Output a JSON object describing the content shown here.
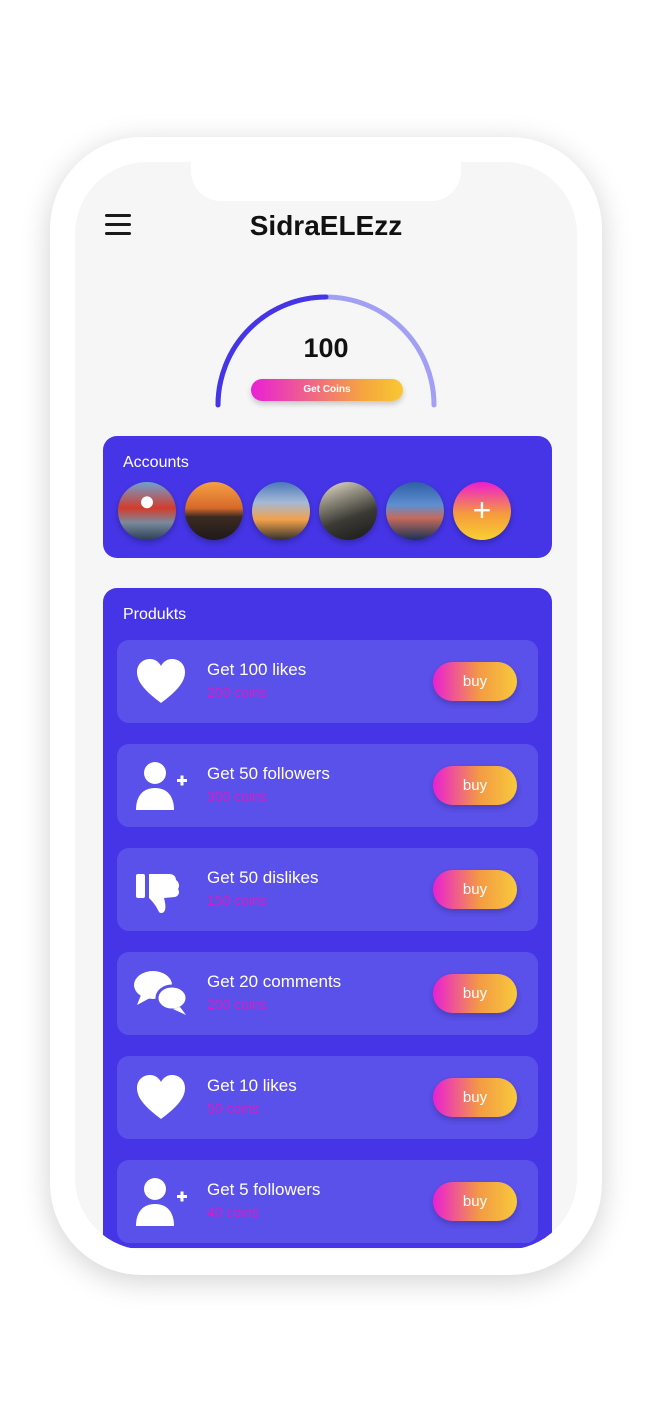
{
  "app": {
    "title": "SidraELEzz"
  },
  "balance": {
    "coins": "100",
    "get_coins_label": "Get Coins",
    "gauge_progress": 0.5
  },
  "accounts": {
    "label": "Accounts",
    "items": [
      {
        "name": "account-avatar-1"
      },
      {
        "name": "account-avatar-2"
      },
      {
        "name": "account-avatar-3"
      },
      {
        "name": "account-avatar-4"
      },
      {
        "name": "account-avatar-5"
      }
    ],
    "add_label": "+"
  },
  "products": {
    "label": "Produkts",
    "items": [
      {
        "title": "Get 100 likes",
        "price": "200 coins",
        "icon": "heart-icon",
        "buy_label": "buy"
      },
      {
        "title": "Get 50 followers",
        "price": "300 coins",
        "icon": "add-user-icon",
        "buy_label": "buy"
      },
      {
        "title": "Get 50 dislikes",
        "price": "150 coins",
        "icon": "thumbs-down-icon",
        "buy_label": "buy"
      },
      {
        "title": "Get 20 comments",
        "price": "200 coins",
        "icon": "comments-icon",
        "buy_label": "buy"
      },
      {
        "title": "Get 10 likes",
        "price": "50 coins",
        "icon": "heart-icon",
        "buy_label": "buy"
      },
      {
        "title": "Get 5 followers",
        "price": "40 coins",
        "icon": "add-user-icon",
        "buy_label": "buy"
      }
    ]
  },
  "colors": {
    "primary": "#4535e6",
    "card": "#5a50ea",
    "gradient_start": "#ea1fd3",
    "gradient_end": "#f8c93a",
    "price": "#d31fc8"
  }
}
